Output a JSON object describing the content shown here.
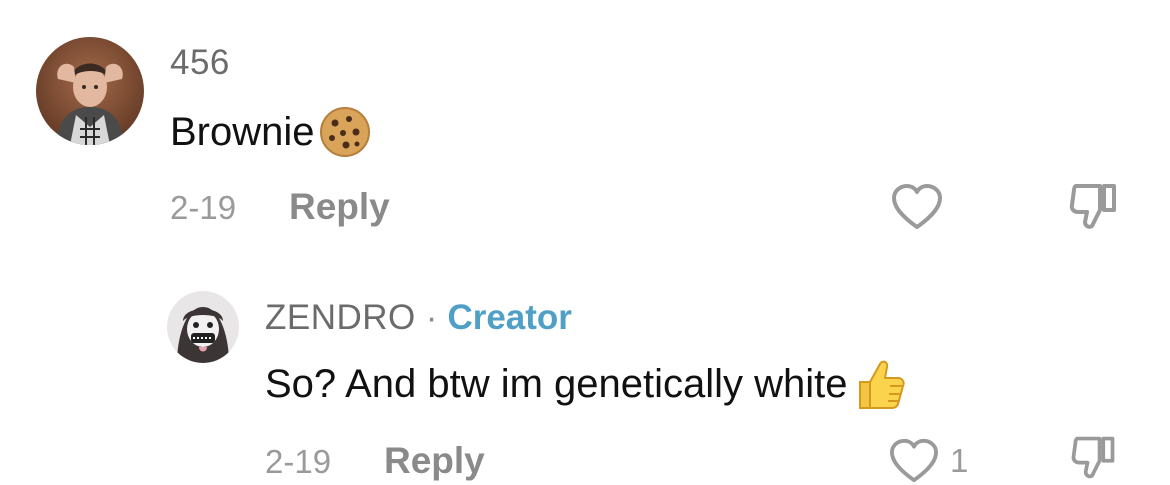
{
  "comments": [
    {
      "username": "456",
      "text": "Brownie",
      "emoji": "cookie",
      "date": "2-19",
      "reply_label": "Reply",
      "like_count": ""
    }
  ],
  "reply": {
    "username": "ZENDRO",
    "separator": "·",
    "badge": "Creator",
    "text": "So? And btw im genetically white",
    "emoji": "thumbs-up",
    "date": "2-19",
    "reply_label": "Reply",
    "like_count": "1"
  },
  "colors": {
    "creator_badge": "#4f9fc7",
    "meta_text": "#9a9a9a",
    "username": "#6b6b6b"
  }
}
